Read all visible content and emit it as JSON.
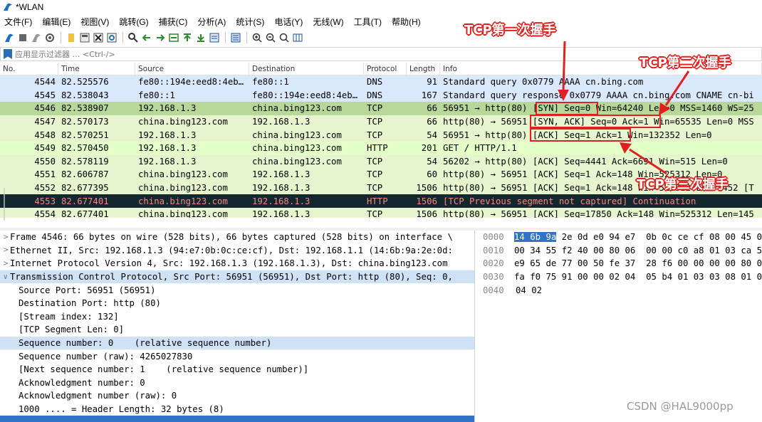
{
  "window": {
    "title": "*WLAN"
  },
  "menu": [
    "文件(F)",
    "编辑(E)",
    "视图(V)",
    "跳转(G)",
    "捕获(C)",
    "分析(A)",
    "统计(S)",
    "电话(Y)",
    "无线(W)",
    "工具(T)",
    "帮助(H)"
  ],
  "filter": {
    "placeholder": "应用显示过滤器 … <Ctrl-/>"
  },
  "columns": {
    "no": "No.",
    "time": "Time",
    "source": "Source",
    "destination": "Destination",
    "protocol": "Protocol",
    "length": "Length",
    "info": "Info"
  },
  "packets": [
    {
      "no": "4544",
      "time": "82.525576",
      "src": "fe80::194e:eed8:4eb…",
      "dst": "fe80::1",
      "proto": "DNS",
      "len": "91",
      "info": "Standard query 0x0779 AAAA cn.bing.com"
    },
    {
      "no": "4545",
      "time": "82.538043",
      "src": "fe80::1",
      "dst": "fe80::194e:eed8:4eb…",
      "proto": "DNS",
      "len": "167",
      "info": "Standard query response 0x0779 AAAA cn.bing.com CNAME cn-bi"
    },
    {
      "no": "4546",
      "time": "82.538907",
      "src": "192.168.1.3",
      "dst": "china.bing123.com",
      "proto": "TCP",
      "len": "66",
      "info": "56951 → http(80) [SYN] Seq=0 Win=64240 Len=0 MSS=1460 WS=25"
    },
    {
      "no": "4547",
      "time": "82.570173",
      "src": "china.bing123.com",
      "dst": "192.168.1.3",
      "proto": "TCP",
      "len": "66",
      "info": "http(80) → 56951 [SYN, ACK] Seq=0 Ack=1 Win=65535 Len=0 MSS"
    },
    {
      "no": "4548",
      "time": "82.570251",
      "src": "192.168.1.3",
      "dst": "china.bing123.com",
      "proto": "TCP",
      "len": "54",
      "info": "56951 → http(80) [ACK] Seq=1 Ack=1 Win=132352 Len=0"
    },
    {
      "no": "4549",
      "time": "82.570450",
      "src": "192.168.1.3",
      "dst": "china.bing123.com",
      "proto": "HTTP",
      "len": "201",
      "info": "GET / HTTP/1.1"
    },
    {
      "no": "4550",
      "time": "82.578119",
      "src": "192.168.1.3",
      "dst": "china.bing123.com",
      "proto": "TCP",
      "len": "54",
      "info": "56202 → http(80) [ACK] Seq=4441 Ack=6691 Win=515 Len=0"
    },
    {
      "no": "4551",
      "time": "82.606787",
      "src": "china.bing123.com",
      "dst": "192.168.1.3",
      "proto": "TCP",
      "len": "60",
      "info": "http(80) → 56951 [ACK] Seq=1 Ack=148 Win=525312 Len=0"
    },
    {
      "no": "4552",
      "time": "82.677395",
      "src": "china.bing123.com",
      "dst": "192.168.1.3",
      "proto": "TCP",
      "len": "1506",
      "info": "http(80) → 56951 [ACK] Seq=1 Ack=148 Win=525312 Len=1452 [T"
    },
    {
      "no": "4553",
      "time": "82.677401",
      "src": "china.bing123.com",
      "dst": "192.168.1.3",
      "proto": "HTTP",
      "len": "1506",
      "info": "[TCP Previous segment not captured] Continuation"
    },
    {
      "no": "4554",
      "time": "82.677401",
      "src": "china.bing123.com",
      "dst": "192.168.1.3",
      "proto": "TCP",
      "len": "1506",
      "info": "http(80) → 56951 [ACK] Seq=17850 Ack=148 Win=525312 Len=145"
    }
  ],
  "annotations": {
    "first": "TCP第一次握手",
    "second": "TCP第二次握手",
    "third": "TCP第三次握手",
    "color": "#e02020"
  },
  "details": [
    {
      "text": "Frame 4546: 66 bytes on wire (528 bits), 66 bytes captured (528 bits) on interface \\"
    },
    {
      "text": "Ethernet II, Src: 192.168.1.3 (94:e7:0b:0c:ce:cf), Dst: 192.168.1.1 (14:6b:9a:2e:0d:"
    },
    {
      "text": "Internet Protocol Version 4, Src: 192.168.1.3 (192.168.1.3), Dst: china.bing123.com"
    },
    {
      "text": "Transmission Control Protocol, Src Port: 56951 (56951), Dst Port: http (80), Seq: 0,"
    },
    {
      "text": "Source Port: 56951 (56951)"
    },
    {
      "text": "Destination Port: http (80)"
    },
    {
      "text": "[Stream index: 132]"
    },
    {
      "text": "[TCP Segment Len: 0]"
    },
    {
      "text": "Sequence number: 0    (relative sequence number)"
    },
    {
      "text": "Sequence number (raw): 4265027830"
    },
    {
      "text": "[Next sequence number: 1    (relative sequence number)]"
    },
    {
      "text": "Acknowledgment number: 0"
    },
    {
      "text": "Acknowledgment number (raw): 0"
    },
    {
      "text": "1000 .... = Header Length: 32 bytes (8)"
    }
  ],
  "bytes": [
    {
      "offset": "0000",
      "sel": "14 6b 9a",
      "rest": " 2e 0d e0 94 e7  0b 0c ce cf 08 00 45 0"
    },
    {
      "offset": "0010",
      "sel": "",
      "rest": "00 34 55 f2 40 00 80 06  00 00 c0 a8 01 03 ca 5"
    },
    {
      "offset": "0020",
      "sel": "",
      "rest": "e9 65 de 77 00 50 fe 37  28 f6 00 00 00 00 80 0"
    },
    {
      "offset": "0030",
      "sel": "",
      "rest": "fa f0 75 91 00 00 02 04  05 b4 01 03 03 08 01 0"
    },
    {
      "offset": "0040",
      "sel": "",
      "rest": "04 02"
    }
  ],
  "watermark": "CSDN @HAL9000pp"
}
